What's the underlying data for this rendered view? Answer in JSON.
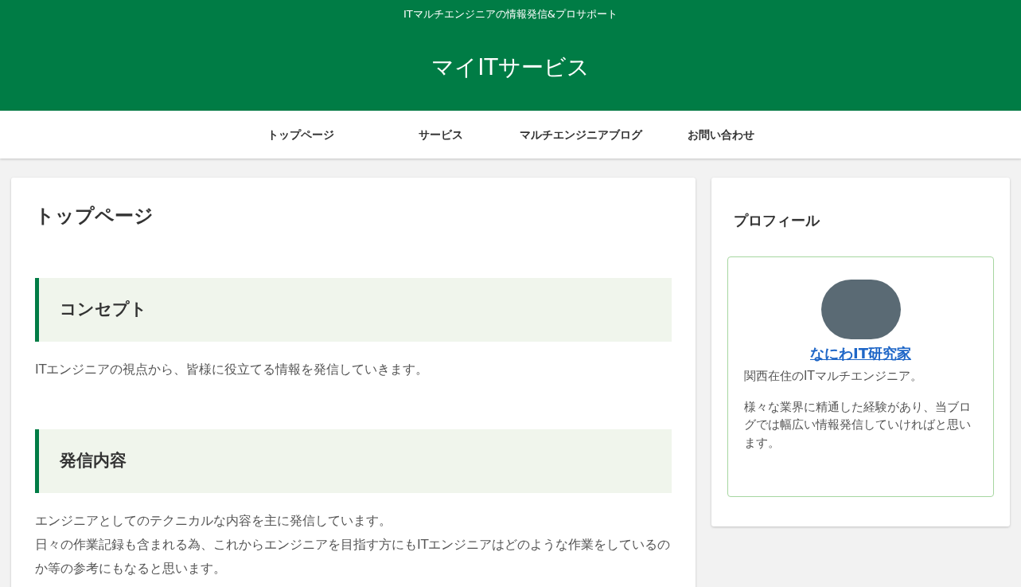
{
  "header": {
    "tagline": "ITマルチエンジニアの情報発信&プロサポート",
    "site_title": "マイITサービス"
  },
  "nav": {
    "items": [
      {
        "label": "トップページ"
      },
      {
        "label": "サービス"
      },
      {
        "label": "マルチエンジニアブログ"
      },
      {
        "label": "お問い合わせ"
      }
    ]
  },
  "main": {
    "page_title": "トップページ",
    "sections": [
      {
        "heading": "コンセプト",
        "paragraphs": [
          "ITエンジニアの視点から、皆様に役立てる情報を発信していきます。"
        ]
      },
      {
        "heading": "発信内容",
        "paragraphs": [
          "エンジニアとしてのテクニカルな内容を主に発信しています。",
          "日々の作業記録も含まれる為、これからエンジニアを目指す方にもITエンジニアはどのような作業をしているのか等の参考にもなると思います。"
        ]
      }
    ]
  },
  "sidebar": {
    "widget_title": "プロフィール",
    "profile": {
      "name": "なにわIT研究家",
      "bio": [
        "関西在住のITマルチエンジニア。",
        "様々な業界に精通した経験があり、当ブログでは幅広い情報発信していければと思います。"
      ]
    }
  }
}
